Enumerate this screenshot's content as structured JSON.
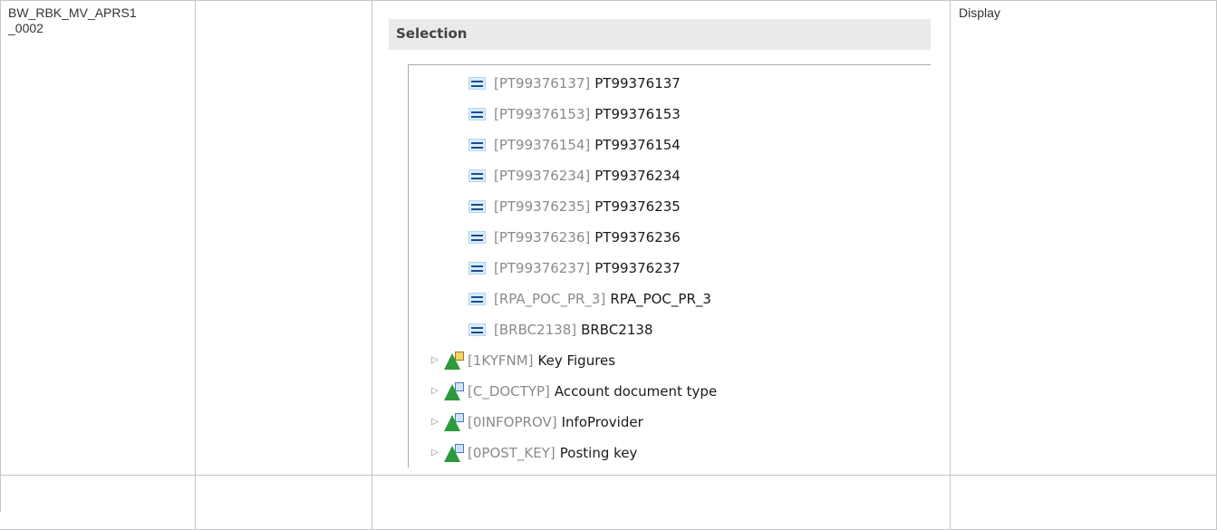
{
  "table": {
    "row1": {
      "name_line1": "BW_RBK_MV_APRS1",
      "name_line2": "_0002",
      "col2": "",
      "action": "Display"
    }
  },
  "selection": {
    "title": "Selection",
    "values": [
      {
        "tech": "[PT99376137]",
        "desc": "PT99376137"
      },
      {
        "tech": "[PT99376153]",
        "desc": "PT99376153"
      },
      {
        "tech": "[PT99376154]",
        "desc": "PT99376154"
      },
      {
        "tech": "[PT99376234]",
        "desc": "PT99376234"
      },
      {
        "tech": "[PT99376235]",
        "desc": "PT99376235"
      },
      {
        "tech": "[PT99376236]",
        "desc": "PT99376236"
      },
      {
        "tech": "[PT99376237]",
        "desc": "PT99376237"
      },
      {
        "tech": "[RPA_POC_PR_3]",
        "desc": "RPA_POC_PR_3"
      },
      {
        "tech": "[BRBC2138]",
        "desc": "BRBC2138"
      }
    ],
    "dimensions": [
      {
        "tech": "[1KYFNM]",
        "desc": "Key Figures",
        "icon": "key-figure-dimension-icon"
      },
      {
        "tech": "[C_DOCTYP]",
        "desc": "Account document type",
        "icon": "characteristic-dimension-icon"
      },
      {
        "tech": "[0INFOPROV]",
        "desc": "InfoProvider",
        "icon": "characteristic-dimension-icon"
      },
      {
        "tech": "[0POST_KEY]",
        "desc": "Posting key",
        "icon": "characteristic-dimension-icon"
      }
    ],
    "value_icon": "equals-operator-icon",
    "expand_glyph": "▷"
  }
}
